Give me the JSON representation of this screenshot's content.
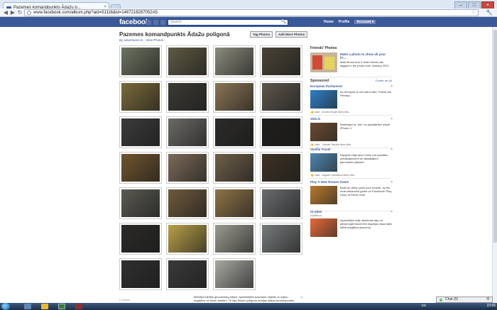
{
  "browser": {
    "tab_title": "Pazemes komandpunkts Āda2u p...",
    "tab_close": "×",
    "url": "www.facebook.com/album.php?aid=51116&id=1467218287052A5",
    "star": "☆",
    "wrench": "🔧",
    "back": "◀",
    "forward": "▶",
    "reload": "↻",
    "window_buttons": [
      "–",
      "□",
      "×"
    ]
  },
  "facebook": {
    "logo": "facebook",
    "search_placeholder": "Search",
    "search_icon": "🔍",
    "nav": [
      "Home",
      "Profile",
      "Account ▾"
    ]
  },
  "album": {
    "title": "Pazemes komandpunkts Āda2u poligonā",
    "byline": "By adventures.lv · View Photos",
    "tag_button": "Tag Photos",
    "add_button": "Add More Photos",
    "location_label": "Location",
    "description": "Meklējot kārtējo geocaching slēpni, apmeklējām pazemes objektu ar sojiņu, angāliem un tukšu šahtām. Te bija Ādažu poligona armijas štāba komandpunkts."
  },
  "photos": [
    {
      "name": "photo-1",
      "bg": "#6d7460"
    },
    {
      "name": "photo-2",
      "bg": "#5f5a44"
    },
    {
      "name": "photo-3",
      "bg": "#8b8b7d"
    },
    {
      "name": "photo-4",
      "bg": "#4a4437"
    },
    {
      "name": "photo-5",
      "bg": "#7a6a3a"
    },
    {
      "name": "photo-6",
      "bg": "#3c3a33"
    },
    {
      "name": "photo-7",
      "bg": "#8a7555"
    },
    {
      "name": "photo-8",
      "bg": "#5d564c"
    },
    {
      "name": "photo-9",
      "bg": "#3b3b3b"
    },
    {
      "name": "photo-10",
      "bg": "#6c6a66"
    },
    {
      "name": "photo-11",
      "bg": "#2c2b29"
    },
    {
      "name": "photo-12",
      "bg": "#1f1e1c"
    },
    {
      "name": "photo-13",
      "bg": "#70552e"
    },
    {
      "name": "photo-14",
      "bg": "#7b6b58"
    },
    {
      "name": "photo-15",
      "bg": "#6e5f49"
    },
    {
      "name": "photo-16",
      "bg": "#3d3224"
    },
    {
      "name": "photo-17",
      "bg": "#5b5a52"
    },
    {
      "name": "photo-18",
      "bg": "#6e5a3c"
    },
    {
      "name": "photo-19",
      "bg": "#8e7347"
    },
    {
      "name": "photo-20",
      "bg": "#6a6c6e"
    },
    {
      "name": "photo-21",
      "bg": "#2b2a28"
    },
    {
      "name": "photo-22",
      "bg": "#b8a04a"
    },
    {
      "name": "photo-23",
      "bg": "#9c9b90"
    },
    {
      "name": "photo-24",
      "bg": "#777b7c"
    },
    {
      "name": "photo-25",
      "bg": "#2f2f2f"
    },
    {
      "name": "photo-26",
      "bg": "#3a3a3a"
    },
    {
      "name": "photo-27",
      "bg": "#a7a9a2"
    }
  ],
  "sidebar": {
    "friends_photos_heading": "Friends' Photos",
    "friends_photo_title": "Make a photo to show all your fri...",
    "friends_photo_body": "Maik Brose and 3 other friends are tagged in the photo from January 2011.",
    "sponsored_heading": "Sponsored",
    "create_ad": "Create an Ad",
    "ads": [
      {
        "title": "European Parliament",
        "body": "An teenpute is not half a bike. Follow the Plenary...",
        "like": "Like",
        "like_note": "· Andra Ergle likes this.",
        "color": "#2d7fc4"
      },
      {
        "title": "Zīds.lv",
        "body": "Nedēļojiet ar \"dar\" un piedalieties izlozē iPhone 4",
        "like": "Like",
        "like_note": "· Vanda Sauka likes this.",
        "color": "#6a4a32"
      },
      {
        "title": "Vanilla Travel",
        "body": "Ripojoši māju faru! Uzzin par karstāko piedāvājumiem un aktuālajiem jaunumiem jānoied",
        "like": "Like",
        "like_note": "· Aigars Smiltains likes this.",
        "color": "#4f86b0"
      },
      {
        "title": "Play A New Roman Game",
        "body": "Build an army, grow your empire, try the most advanced game on Facebook! Play Glory of Rome now!",
        "like": "",
        "like_note": "",
        "color": "#b77a2c"
      },
      {
        "title": "IX-Sites",
        "body": "Apmeklējot māju facebook lapu ar pievienojiet fanu!Vien iespējas visas labā kārtā megābus jaunuma",
        "like": "",
        "like_note": "",
        "color": "#e46b3a"
      }
    ],
    "ad_url": "IXsites.lv"
  },
  "chat": {
    "label": "Chat (0)"
  },
  "taskbar": {
    "lang": "EN",
    "clock": "23:56"
  }
}
